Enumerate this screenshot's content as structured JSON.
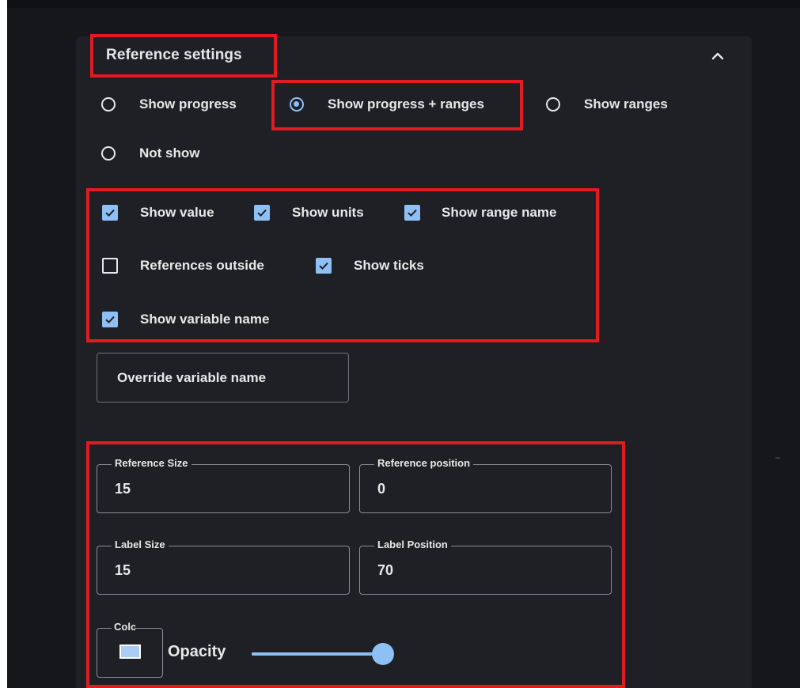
{
  "header": {
    "title": "Reference settings"
  },
  "display_mode": {
    "options": [
      {
        "label": "Show progress",
        "selected": false
      },
      {
        "label": "Show progress + ranges",
        "selected": true
      },
      {
        "label": "Show ranges",
        "selected": false
      },
      {
        "label": "Not show",
        "selected": false
      }
    ]
  },
  "checkboxes": {
    "show_value": {
      "label": "Show value",
      "checked": true
    },
    "show_units": {
      "label": "Show units",
      "checked": true
    },
    "show_range_name": {
      "label": "Show range name",
      "checked": true
    },
    "references_outside": {
      "label": "References outside",
      "checked": false
    },
    "show_ticks": {
      "label": "Show ticks",
      "checked": true
    },
    "show_variable_name": {
      "label": "Show variable name",
      "checked": true
    }
  },
  "override_button": {
    "label": "Override variable name"
  },
  "fields": {
    "reference_size": {
      "label": "Reference Size",
      "value": "15"
    },
    "reference_position": {
      "label": "Reference position",
      "value": "0"
    },
    "label_size": {
      "label": "Label Size",
      "value": "15"
    },
    "label_position": {
      "label": "Label Position",
      "value": "70"
    }
  },
  "color": {
    "label": "Color",
    "swatch": "#a9cdf5"
  },
  "opacity": {
    "label": "Opacity",
    "value": 1.0
  },
  "colors": {
    "accent": "#8ec0f5",
    "highlight": "#e01b22",
    "panel": "#1e2025",
    "background": "#15171b",
    "text": "#e8e8e8"
  }
}
